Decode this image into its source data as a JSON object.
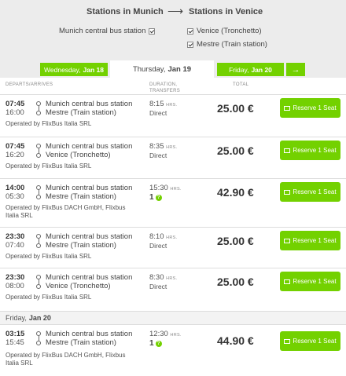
{
  "header": {
    "from_title": "Stations in Munich",
    "arrow": "⟶",
    "to_title": "Stations in Venice",
    "from_stations": [
      {
        "label": "Munich central bus station",
        "checked": true
      }
    ],
    "to_stations": [
      {
        "label": "Venice (Tronchetto)",
        "checked": true
      },
      {
        "label": "Mestre (Train station)",
        "checked": true
      }
    ]
  },
  "tabs": {
    "prev": {
      "day": "Wednesday,",
      "date": "Jan 18"
    },
    "current": {
      "day": "Thursday,",
      "date": "Jan 19"
    },
    "next": {
      "day": "Friday,",
      "date": "Jan 20"
    },
    "next_arrow": "→"
  },
  "columns": {
    "departs": "DEPARTS/ARRIVES",
    "duration_1": "DURATION,",
    "duration_2": "TRANSFERS",
    "total": "TOTAL"
  },
  "rows": [
    {
      "dep": "07:45",
      "arr": "16:00",
      "from": "Munich central bus station",
      "to": "Mestre (Train station)",
      "operator": "Operated by FlixBus Italia SRL",
      "duration": "8:15",
      "unit": "HRS.",
      "transfers": "Direct",
      "price": "25.00 €",
      "button": "Reserve 1 Seat"
    },
    {
      "dep": "07:45",
      "arr": "16:20",
      "from": "Munich central bus station",
      "to": "Venice (Tronchetto)",
      "operator": "Operated by FlixBus Italia SRL",
      "duration": "8:35",
      "unit": "HRS.",
      "transfers": "Direct",
      "price": "25.00 €",
      "button": "Reserve 1 Seat"
    },
    {
      "dep": "14:00",
      "arr": "05:30",
      "from": "Munich central bus station",
      "to": "Mestre (Train station)",
      "operator": "Operated by FlixBus DACH GmbH, Flixbus Italia SRL",
      "duration": "15:30",
      "unit": "HRS.",
      "transfers": "1",
      "price": "42.90 €",
      "button": "Reserve 1 Seat"
    },
    {
      "dep": "23:30",
      "arr": "07:40",
      "from": "Munich central bus station",
      "to": "Mestre (Train station)",
      "operator": "Operated by FlixBus Italia SRL",
      "duration": "8:10",
      "unit": "HRS.",
      "transfers": "Direct",
      "price": "25.00 €",
      "button": "Reserve 1 Seat"
    },
    {
      "dep": "23:30",
      "arr": "08:00",
      "from": "Munich central bus station",
      "to": "Venice (Tronchetto)",
      "operator": "Operated by FlixBus Italia SRL",
      "duration": "8:30",
      "unit": "HRS.",
      "transfers": "Direct",
      "price": "25.00 €",
      "button": "Reserve 1 Seat"
    }
  ],
  "next_day": {
    "day": "Friday,",
    "date": "Jan 20"
  },
  "next_day_rows": [
    {
      "dep": "03:15",
      "arr": "15:45",
      "from": "Munich central bus station",
      "to": "Mestre (Train station)",
      "operator": "Operated by FlixBus DACH GmbH, Flixbus Italia SRL",
      "duration": "12:30",
      "unit": "HRS.",
      "transfers": "1",
      "price": "44.90 €",
      "button": "Reserve 1 Seat"
    }
  ],
  "colors": {
    "accent": "#73d100",
    "background": "#ececec"
  }
}
